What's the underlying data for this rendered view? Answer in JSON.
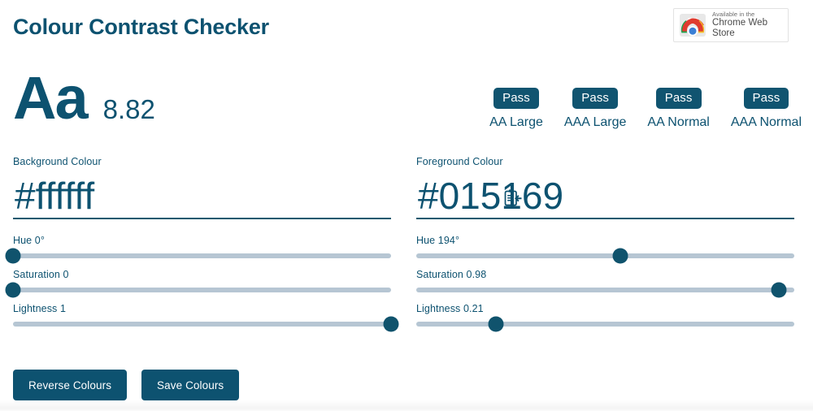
{
  "app": {
    "title": "Colour Contrast Checker",
    "accent_colour": "#0d5270",
    "badge_colour": "#105470",
    "slider_track_colour": "#b6c6d3"
  },
  "promo": {
    "badge_line1": "Available in the",
    "badge_line2": "Chrome Web Store",
    "icon": "chrome-logo-icon"
  },
  "preview": {
    "sample_text": "Aa",
    "contrast_ratio": "8.82"
  },
  "compliance": [
    {
      "result": "Pass",
      "label": "AA Large"
    },
    {
      "result": "Pass",
      "label": "AAA Large"
    },
    {
      "result": "Pass",
      "label": "AA Normal"
    },
    {
      "result": "Pass",
      "label": "AAA Normal"
    }
  ],
  "background": {
    "field_label": "Background Colour",
    "hex_value": "#ffffff",
    "hex_placeholder": "#ffffff",
    "paste_icon": "paste-clipboard-icon",
    "sliders": [
      {
        "label": "Hue 0°",
        "percent": 0
      },
      {
        "label": "Saturation 0",
        "percent": 0
      },
      {
        "label": "Lightness 1",
        "percent": 100
      }
    ]
  },
  "foreground": {
    "field_label": "Foreground Colour",
    "hex_value": "#015169",
    "hex_placeholder": "#015169",
    "paste_icon": "paste-clipboard-icon",
    "sliders": [
      {
        "label": "Hue 194°",
        "percent": 54
      },
      {
        "label": "Saturation 0.98",
        "percent": 96
      },
      {
        "label": "Lightness 0.21",
        "percent": 21
      }
    ]
  },
  "actions": {
    "reverse_label": "Reverse Colours",
    "save_label": "Save Colours"
  }
}
